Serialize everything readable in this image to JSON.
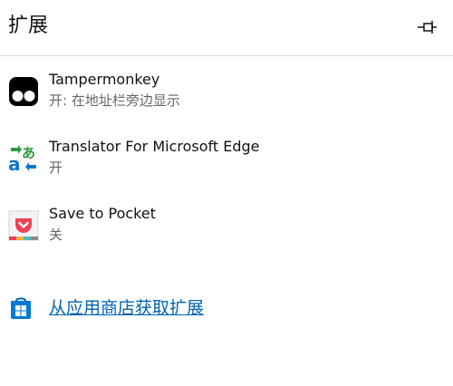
{
  "header": {
    "title": "扩展",
    "pin_icon": "pin-icon"
  },
  "extensions": [
    {
      "name": "Tampermonkey",
      "status": "开: 在地址栏旁边显示",
      "icon": "tampermonkey-icon"
    },
    {
      "name": "Translator For Microsoft Edge",
      "status": "开",
      "icon": "translator-icon"
    },
    {
      "name": "Save to Pocket",
      "status": "关",
      "icon": "pocket-icon"
    }
  ],
  "store": {
    "link_label": "从应用商店获取扩展",
    "icon": "store-bag-icon"
  },
  "colors": {
    "link": "#0063b1",
    "status_text": "#666666",
    "translator_blue": "#0f78c8",
    "translator_green": "#2e9a3c",
    "pocket_red": "#ef4056"
  }
}
